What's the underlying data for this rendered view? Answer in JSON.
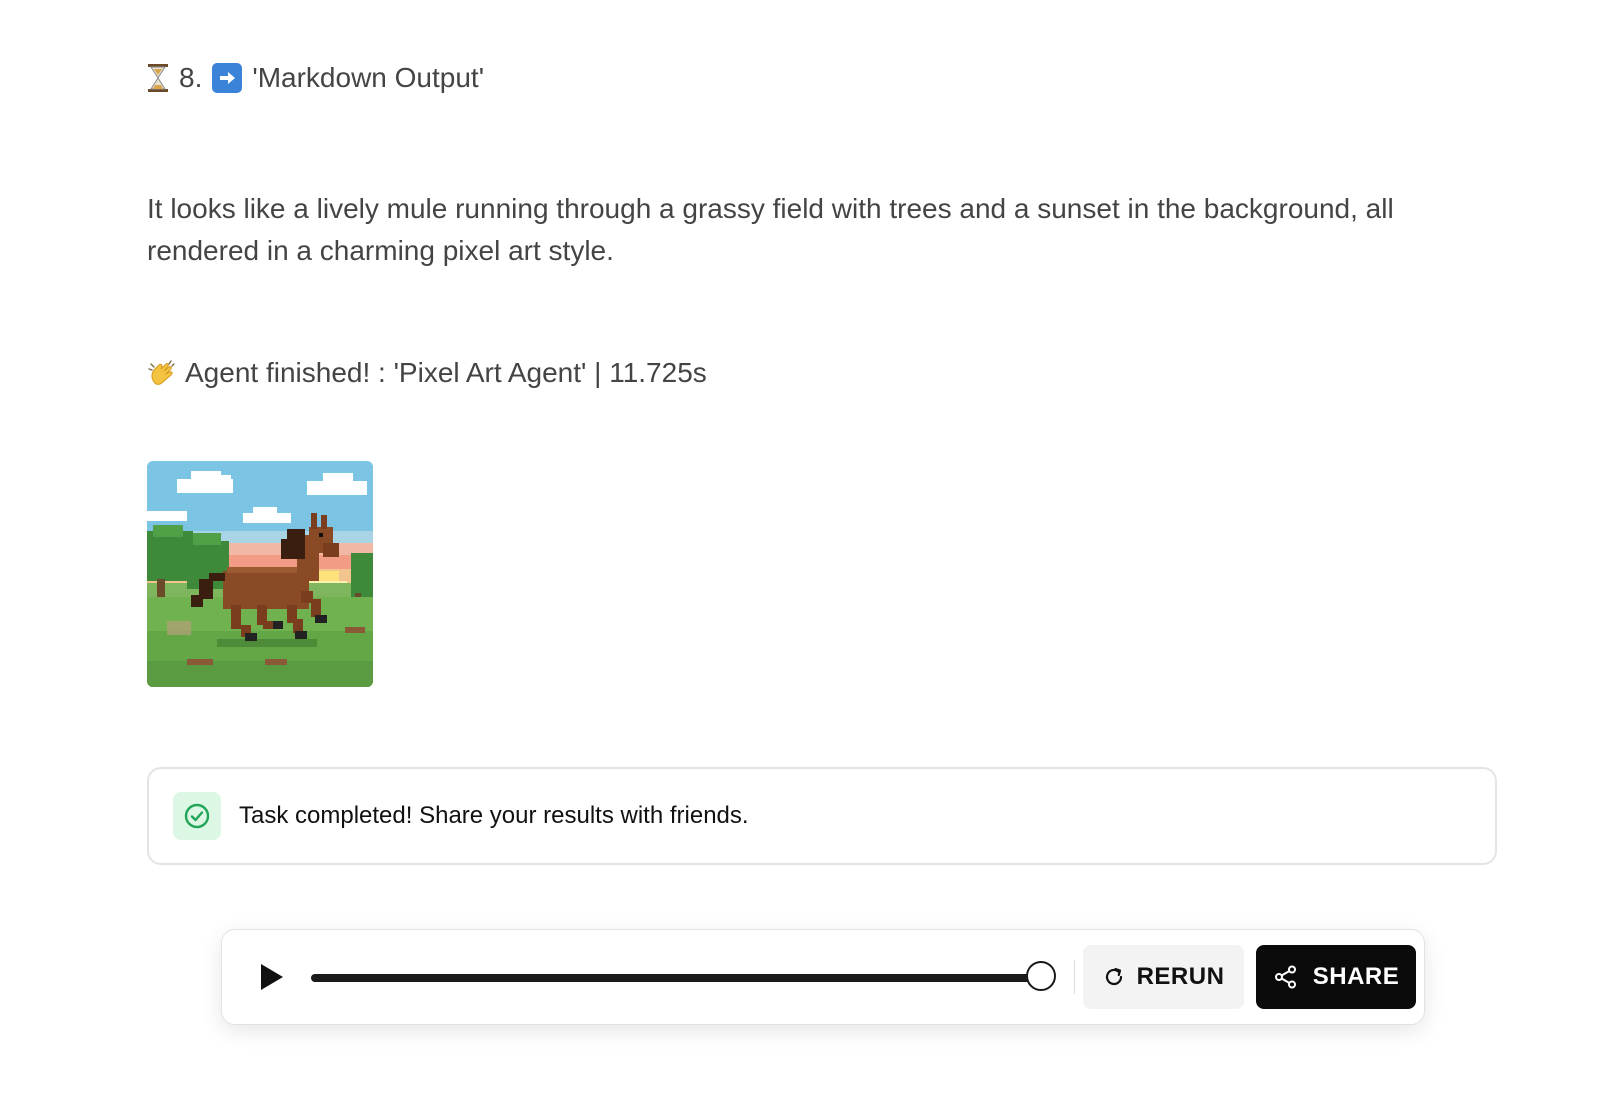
{
  "step": {
    "number": "8.",
    "icon_before": "hourglass-icon",
    "icon_arrow": "right-arrow-icon",
    "label": "'Markdown Output'"
  },
  "output": {
    "description": "It looks like a lively mule running through a grassy field with trees and a sunset in the background, all rendered in a charming pixel art style."
  },
  "finished": {
    "icon": "waving-hand-icon",
    "text": "Agent finished! : 'Pixel Art Agent' | 11.725s"
  },
  "image": {
    "subject": "pixel-art-mule"
  },
  "notice": {
    "icon": "check-circle-icon",
    "text": "Task completed! Share your results with friends."
  },
  "player": {
    "progress": 1.0,
    "rerun_label": "RERUN",
    "share_label": "SHARE"
  },
  "colors": {
    "accent_dark": "#0a0a0a",
    "success_bg": "#dcf7e3",
    "success": "#22a559",
    "arrow_blue": "#3b82d9"
  }
}
